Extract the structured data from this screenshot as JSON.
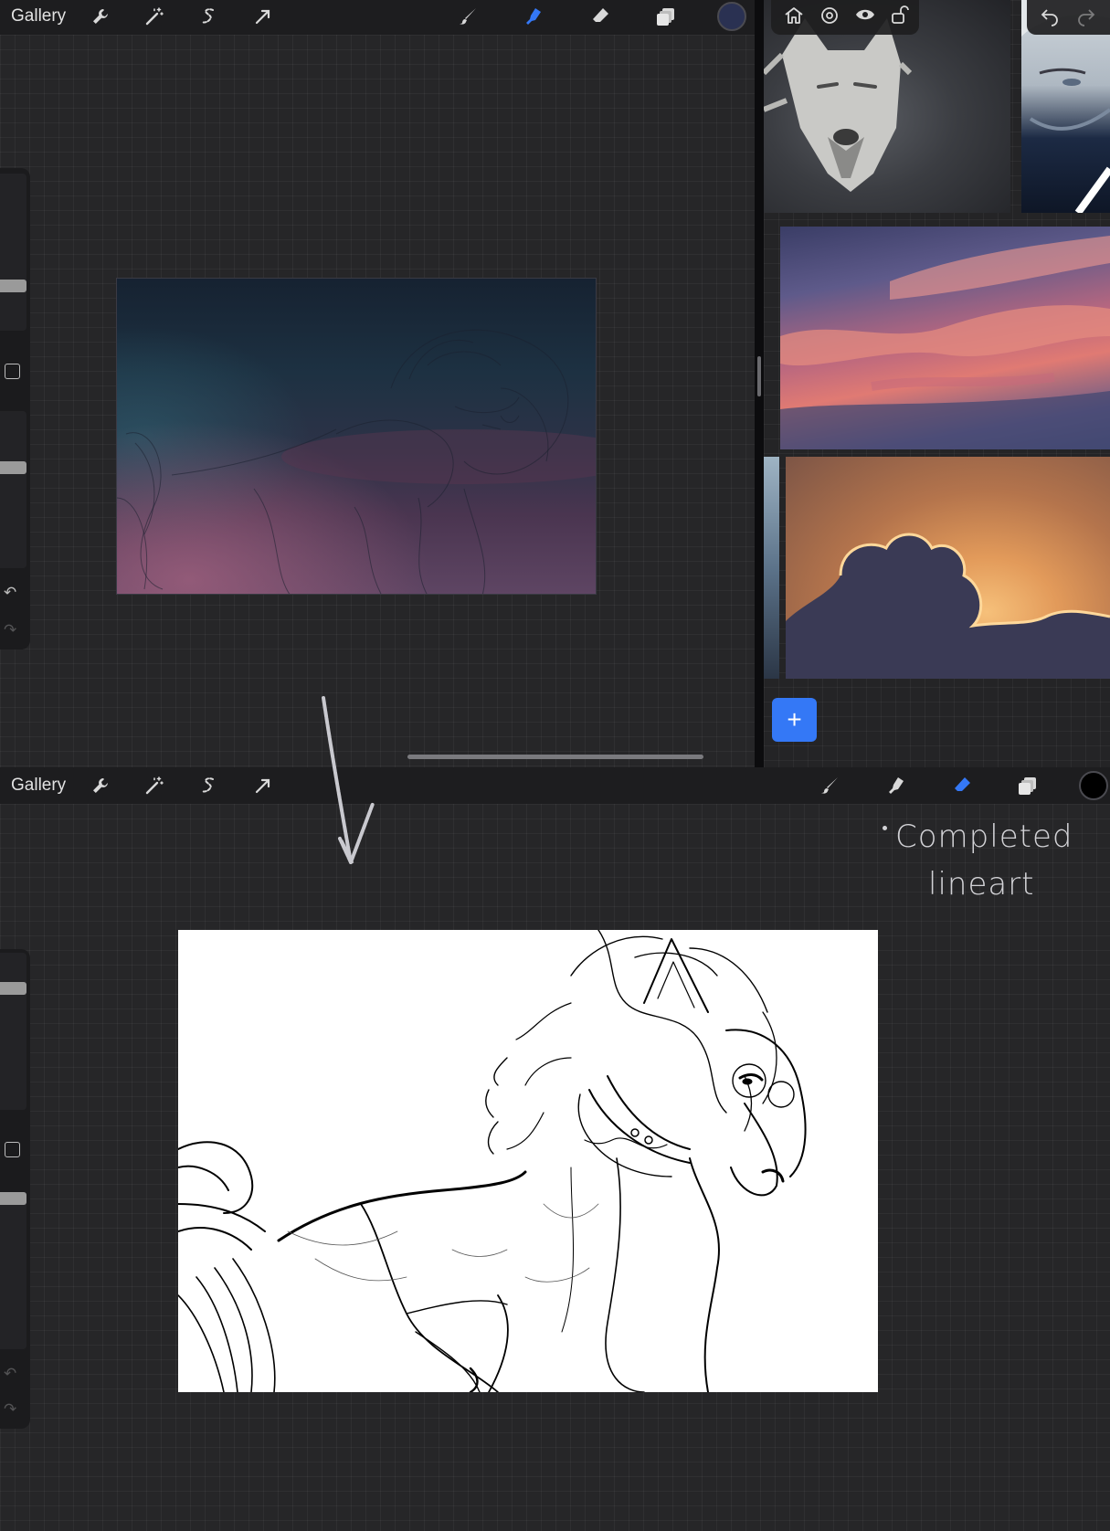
{
  "top_app": {
    "gallery_label": "Gallery",
    "tools_left": [
      "wrench-icon",
      "magic-wand-icon",
      "selection-s-icon",
      "transform-arrow-icon"
    ],
    "tools_right": [
      "brush-icon",
      "smudge-icon",
      "eraser-icon",
      "layers-icon"
    ],
    "active_tool": "smudge-icon",
    "color_swatch": "#2a3152",
    "accent": "#3478f6"
  },
  "reference_panel": {
    "toolbar_icons": [
      "home-icon",
      "settings-icon",
      "eye-icon",
      "unlock-icon"
    ],
    "undo_redo_icons": [
      "undo-icon",
      "redo-icon"
    ],
    "add_button": "+"
  },
  "bottom_app": {
    "gallery_label": "Gallery",
    "tools_left": [
      "wrench-icon",
      "magic-wand-icon",
      "selection-s-icon",
      "transform-arrow-icon"
    ],
    "tools_right": [
      "brush-icon",
      "smudge-icon",
      "eraser-icon",
      "layers-icon"
    ],
    "active_tool": "eraser-icon",
    "color_swatch": "#000000"
  },
  "annotation": {
    "line1": "Completed",
    "line2": "lineart"
  }
}
